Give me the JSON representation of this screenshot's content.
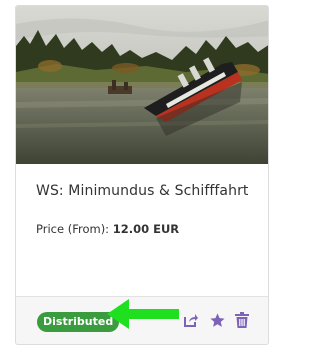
{
  "card": {
    "title": "WS: Minimundus & Schifffahrt",
    "price_label": "Price (From):",
    "price_value": "12.00 EUR",
    "status": "Distributed"
  },
  "icons": {
    "share": "share-icon",
    "favorite": "star-icon",
    "delete": "trash-icon"
  },
  "colors": {
    "status_green": "#3a9b3f",
    "accent_purple": "#7c63b8",
    "arrow_green": "#1ee01e"
  }
}
